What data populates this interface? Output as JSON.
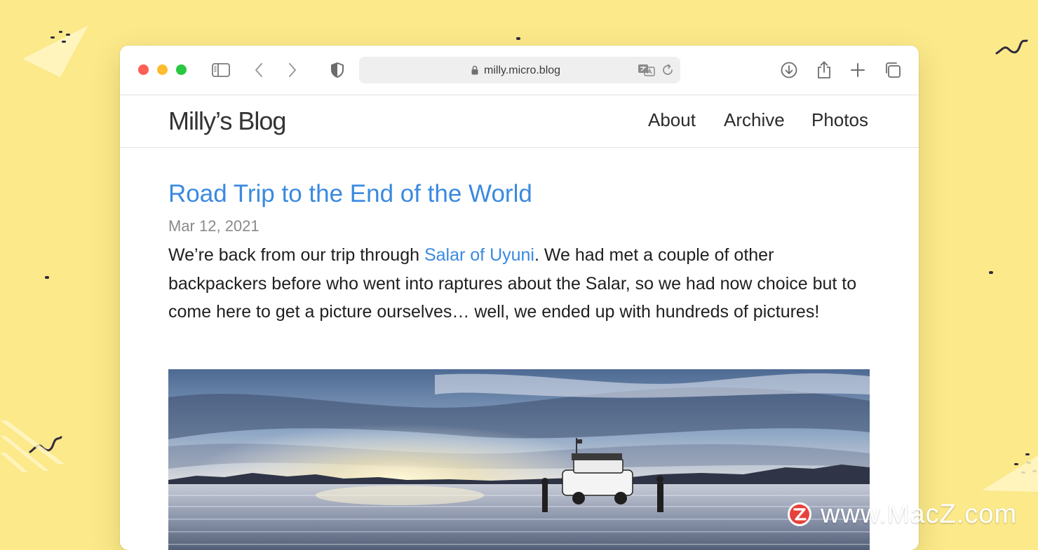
{
  "browser": {
    "url": "milly.micro.blog"
  },
  "blog": {
    "title": "Milly’s Blog",
    "nav": {
      "about": "About",
      "archive": "Archive",
      "photos": "Photos"
    }
  },
  "post": {
    "title": "Road Trip to the End of the World",
    "date": "Mar 12, 2021",
    "body_before_link": "We’re back from our trip through ",
    "link_text": "Salar of Uyuni",
    "body_after_link": ". We had met a couple of other backpackers before who went into raptures about the Salar, so we had now choice but to come here to get a picture ourselves… well, we ended up with hundreds of pictures!"
  },
  "watermark": {
    "text": "www.MacZ.com"
  },
  "colors": {
    "background": "#fbe98a",
    "link": "#3a89e0",
    "traffic_red": "#fe5f57",
    "traffic_yellow": "#febc2e",
    "traffic_green": "#28c840"
  },
  "icons": {
    "toolbar": [
      "sidebar-icon",
      "back-icon",
      "forward-icon",
      "privacy-shield-icon",
      "download-icon",
      "share-icon",
      "new-tab-icon",
      "tab-overview-icon"
    ],
    "urlbar": [
      "lock-icon",
      "translate-icon",
      "reload-icon"
    ]
  }
}
